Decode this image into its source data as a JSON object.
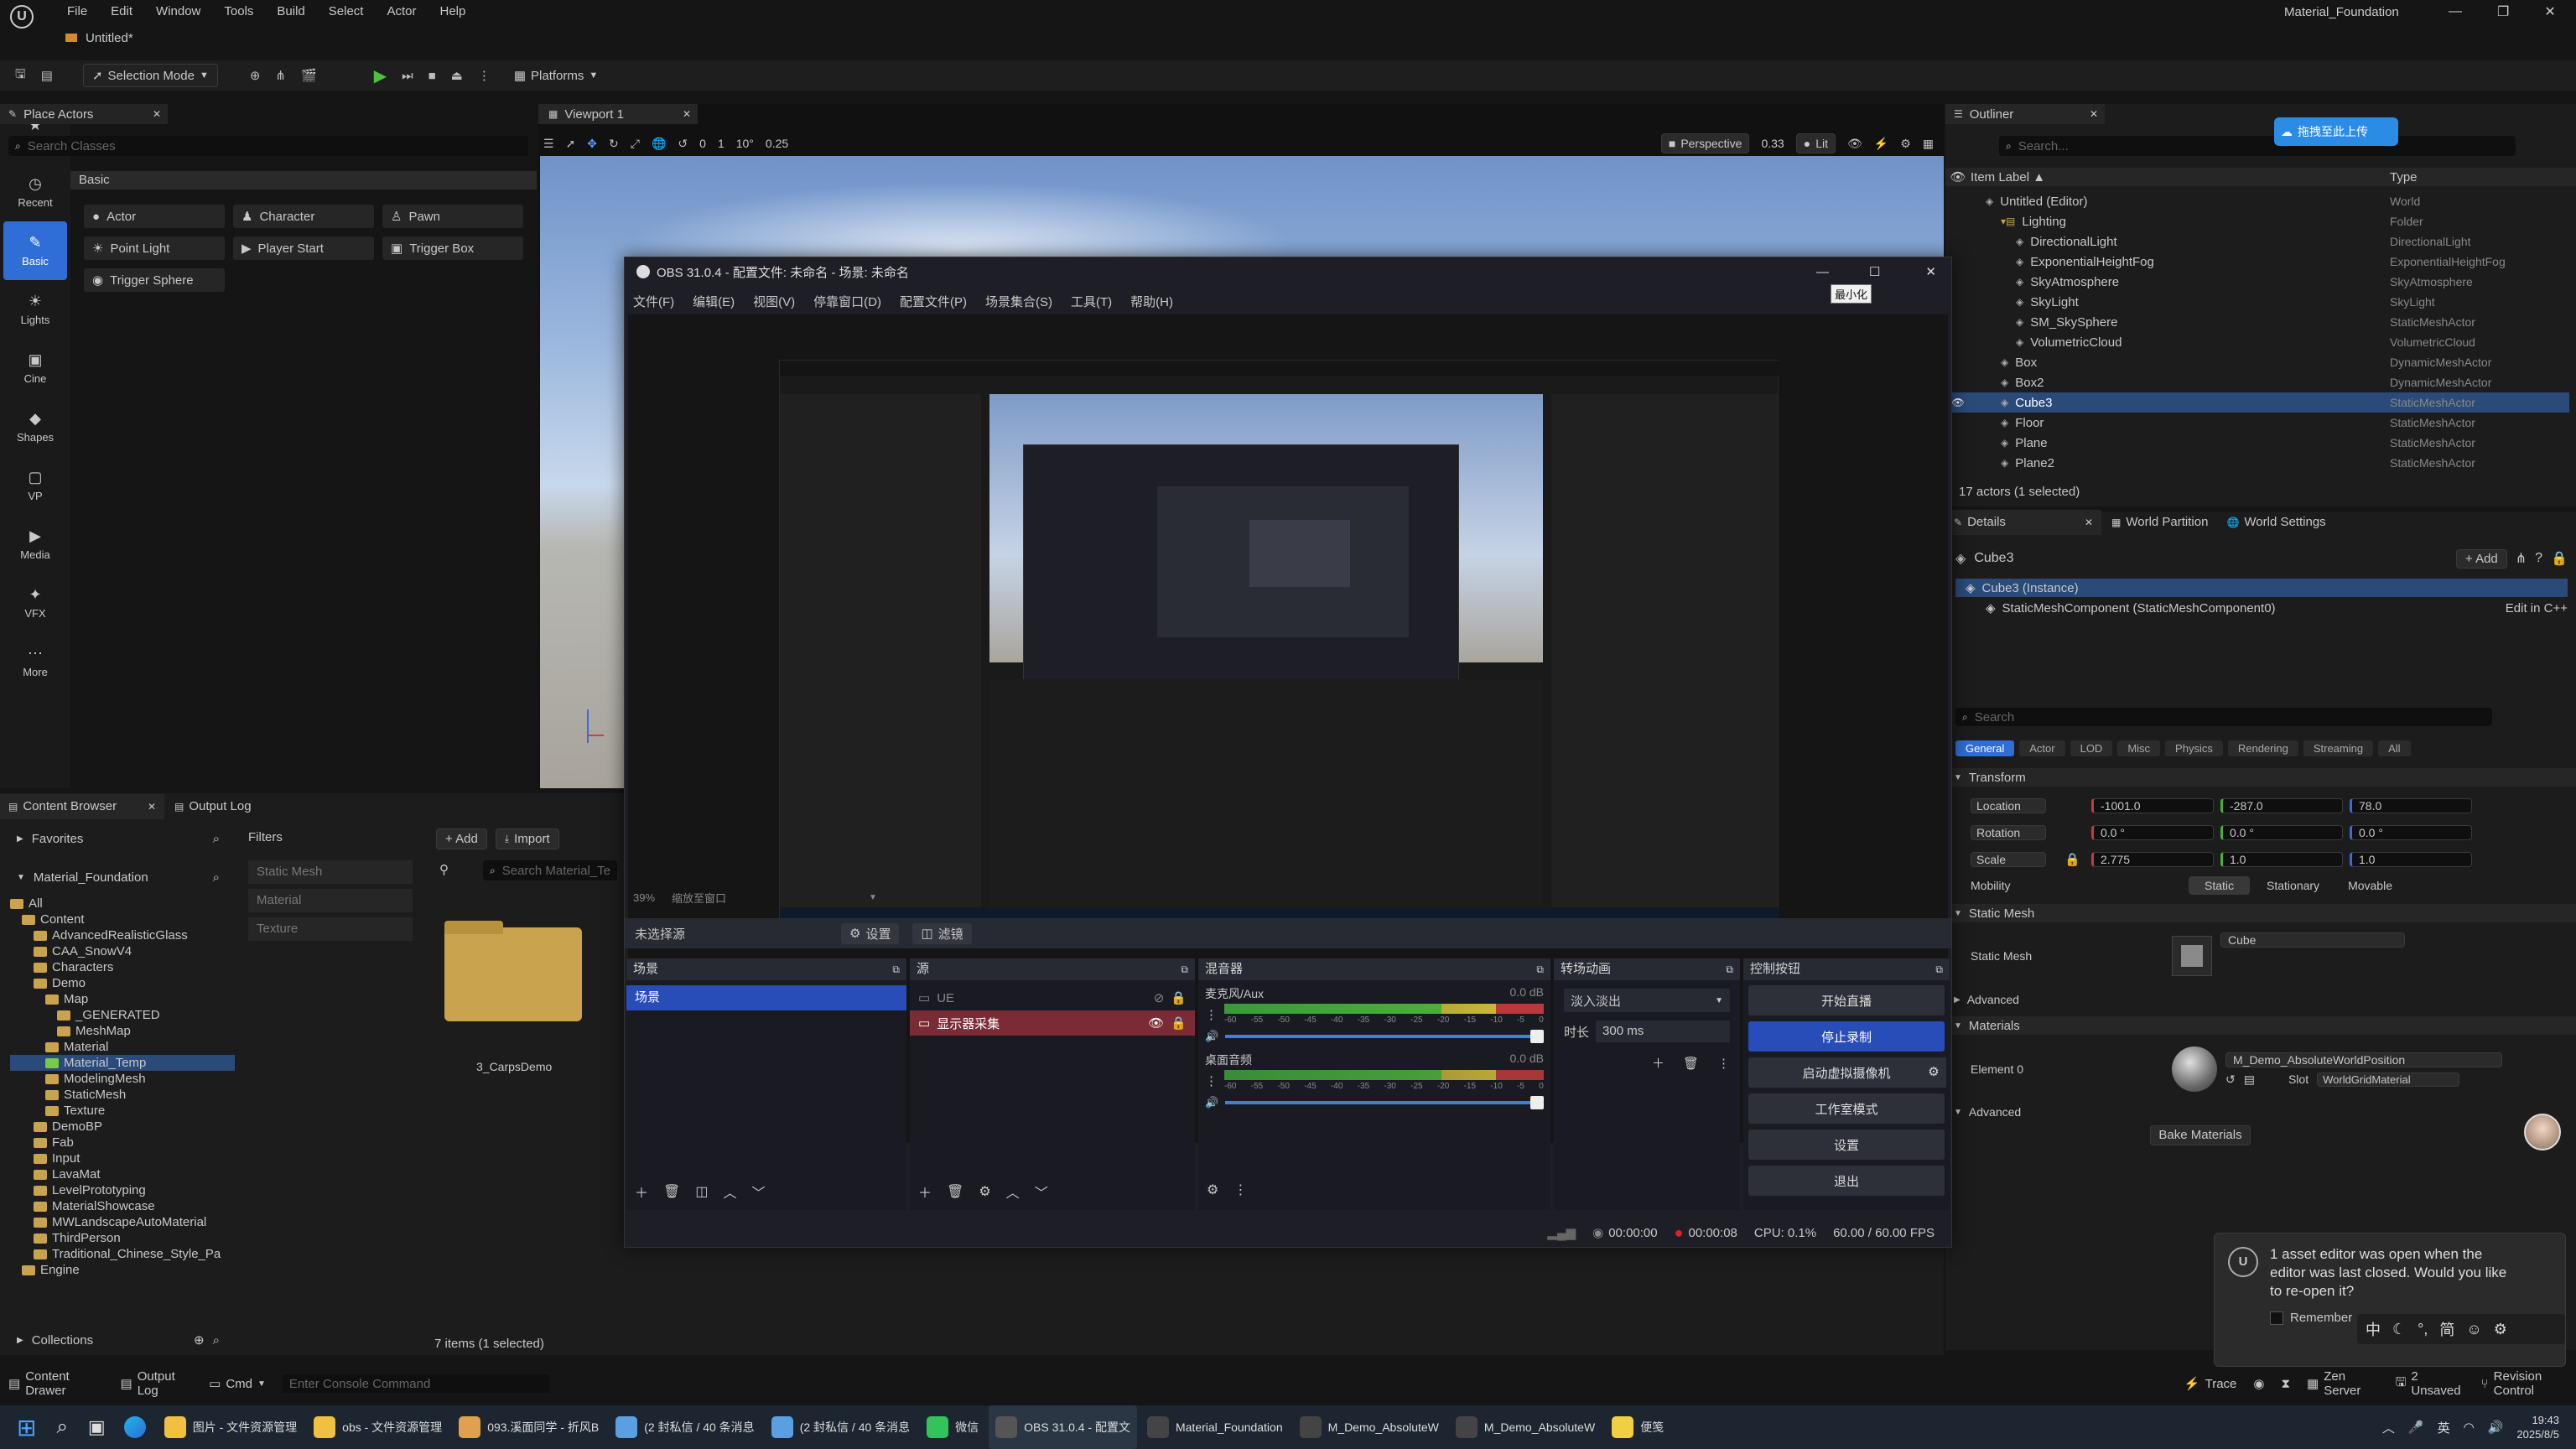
{
  "app": {
    "title": "Material_Foundation",
    "tab": "Untitled*"
  },
  "menu": [
    "File",
    "Edit",
    "Window",
    "Tools",
    "Build",
    "Select",
    "Actor",
    "Help"
  ],
  "toolbar": {
    "selection_mode": "Selection Mode",
    "platforms": "Platforms"
  },
  "place_actors": {
    "tab": "Place Actors",
    "search_placeholder": "Search Classes",
    "section": "Basic",
    "items": [
      "Actor",
      "Character",
      "Pawn",
      "Point Light",
      "Player Start",
      "Trigger Box",
      "Trigger Sphere"
    ],
    "side": [
      "Favorites",
      "Recent",
      "Basic",
      "Lights",
      "Cine",
      "Shapes",
      "VP",
      "Media",
      "VFX",
      "More"
    ]
  },
  "viewport": {
    "tab": "Viewport 1",
    "perspective": "Perspective",
    "fov": "0.33",
    "lit": "Lit",
    "snap_move": "10",
    "snap_rot": "10°",
    "snap_scale": "0.25",
    "grid": "0",
    "cam": "1"
  },
  "outliner": {
    "tab": "Outliner",
    "search_placeholder": "Search...",
    "upload_btn": "拖拽至此上传",
    "col_label": "Item Label ▲",
    "col_type": "Type",
    "rows": [
      {
        "label": "Untitled (Editor)",
        "type": "World",
        "indent": 1
      },
      {
        "label": "Lighting",
        "type": "Folder",
        "indent": 2
      },
      {
        "label": "DirectionalLight",
        "type": "DirectionalLight",
        "indent": 3
      },
      {
        "label": "ExponentialHeightFog",
        "type": "ExponentialHeightFog",
        "indent": 3
      },
      {
        "label": "SkyAtmosphere",
        "type": "SkyAtmosphere",
        "indent": 3
      },
      {
        "label": "SkyLight",
        "type": "SkyLight",
        "indent": 3
      },
      {
        "label": "SM_SkySphere",
        "type": "StaticMeshActor",
        "indent": 3
      },
      {
        "label": "VolumetricCloud",
        "type": "VolumetricCloud",
        "indent": 3
      },
      {
        "label": "Box",
        "type": "DynamicMeshActor",
        "indent": 2
      },
      {
        "label": "Box2",
        "type": "DynamicMeshActor",
        "indent": 2
      },
      {
        "label": "Cube3",
        "type": "StaticMeshActor",
        "indent": 2,
        "selected": true
      },
      {
        "label": "Floor",
        "type": "StaticMeshActor",
        "indent": 2
      },
      {
        "label": "Plane",
        "type": "StaticMeshActor",
        "indent": 2
      },
      {
        "label": "Plane2",
        "type": "StaticMeshActor",
        "indent": 2
      }
    ],
    "status": "17 actors (1 selected)"
  },
  "details": {
    "tab": "Details",
    "tab2": "World Partition",
    "tab3": "World Settings",
    "object": "Cube3",
    "add": "+ Add",
    "instance": "Cube3 (Instance)",
    "component": "StaticMeshComponent (StaticMeshComponent0)",
    "edit_cpp": "Edit in C++",
    "search_placeholder": "Search",
    "filters": [
      "General",
      "Actor",
      "LOD",
      "Misc",
      "Physics",
      "Rendering",
      "Streaming",
      "All"
    ],
    "transform": "Transform",
    "location": {
      "label": "Location",
      "x": "-1001.0",
      "y": "-287.0",
      "z": "78.0"
    },
    "rotation": {
      "label": "Rotation",
      "x": "0.0 °",
      "y": "0.0 °",
      "z": "0.0 °"
    },
    "scale": {
      "label": "Scale",
      "x": "2.775",
      "y": "1.0",
      "z": "1.0"
    },
    "mobility": {
      "label": "Mobility",
      "opts": [
        "Static",
        "Stationary",
        "Movable"
      ]
    },
    "static_mesh_section": "Static Mesh",
    "static_mesh_label": "Static Mesh",
    "static_mesh_value": "Cube",
    "advanced": "Advanced",
    "materials": "Materials",
    "element0": "Element 0",
    "material_value": "M_Demo_AbsoluteWorldPosition",
    "slot_label": "Slot",
    "slot_value": "WorldGridMaterial",
    "bake": "Bake Materials"
  },
  "content_browser": {
    "tab": "Content Browser",
    "tab2": "Output Log",
    "favorites": "Favorites",
    "project": "Material_Foundation",
    "add": "+ Add",
    "import": "Import",
    "search_placeholder": "Search Material_Te",
    "filters_title": "Filters",
    "filters": [
      "Static Mesh",
      "Material",
      "Texture"
    ],
    "tree": [
      {
        "label": "All",
        "d": 0
      },
      {
        "label": "Content",
        "d": 1
      },
      {
        "label": "AdvancedRealisticGlass",
        "d": 2
      },
      {
        "label": "CAA_SnowV4",
        "d": 2
      },
      {
        "label": "Characters",
        "d": 2
      },
      {
        "label": "Demo",
        "d": 2
      },
      {
        "label": "Map",
        "d": 3
      },
      {
        "label": "_GENERATED",
        "d": 4
      },
      {
        "label": "MeshMap",
        "d": 4
      },
      {
        "label": "Material",
        "d": 3
      },
      {
        "label": "Material_Temp",
        "d": 3,
        "selected": true
      },
      {
        "label": "ModelingMesh",
        "d": 3
      },
      {
        "label": "StaticMesh",
        "d": 3
      },
      {
        "label": "Texture",
        "d": 3
      },
      {
        "label": "DemoBP",
        "d": 2
      },
      {
        "label": "Fab",
        "d": 2
      },
      {
        "label": "Input",
        "d": 2
      },
      {
        "label": "LavaMat",
        "d": 2
      },
      {
        "label": "LevelPrototyping",
        "d": 2
      },
      {
        "label": "MaterialShowcase",
        "d": 2
      },
      {
        "label": "MWLandscapeAutoMaterial",
        "d": 2
      },
      {
        "label": "ThirdPerson",
        "d": 2
      },
      {
        "label": "Traditional_Chinese_Style_Pa",
        "d": 2
      },
      {
        "label": "Engine",
        "d": 1
      }
    ],
    "asset_name": "3_CarpsDemo",
    "collections": "Collections",
    "items_status": "7 items (1 selected)"
  },
  "bottom_bar": {
    "drawer": "Content Drawer",
    "output": "Output Log",
    "cmd": "Cmd",
    "console_placeholder": "Enter Console Command",
    "trace": "Trace",
    "zen": "Zen Server",
    "unsaved": "2 Unsaved",
    "revision": "Revision Control"
  },
  "toast": {
    "message": "1 asset editor was open when the editor was last closed. Would you like to re-open it?",
    "remember": "Remember"
  },
  "obs": {
    "title": "OBS 31.0.4 - 配置文件: 未命名 - 场景: 未命名",
    "menu": [
      "文件(F)",
      "编辑(E)",
      "视图(V)",
      "停靠窗口(D)",
      "配置文件(P)",
      "场景集合(S)",
      "工具(T)",
      "帮助(H)"
    ],
    "tooltip": "最小化",
    "zoom": "39%",
    "preview_label": "缩放至窗口",
    "no_source": "未选择源",
    "settings_btn": "设置",
    "filters_btn": "滤镜",
    "scenes_title": "场景",
    "scene_item": "场景",
    "sources_title": "源",
    "sources": [
      "UE",
      "显示器采集"
    ],
    "mixer_title": "混音器",
    "mixer": [
      {
        "name": "麦克风/Aux",
        "db": "0.0 dB"
      },
      {
        "name": "桌面音频",
        "db": "0.0 dB"
      }
    ],
    "meter_ticks": [
      "-60",
      "-55",
      "-50",
      "-45",
      "-40",
      "-35",
      "-30",
      "-25",
      "-20",
      "-15",
      "-10",
      "-5",
      "0"
    ],
    "transitions_title": "转场动画",
    "transition": "淡入淡出",
    "duration_label": "时长",
    "duration": "300 ms",
    "controls_title": "控制按钮",
    "controls": [
      "开始直播",
      "停止录制",
      "启动虚拟摄像机",
      "工作室模式",
      "设置",
      "退出"
    ],
    "status": {
      "stream_time": "00:00:00",
      "rec_time": "00:00:08",
      "cpu": "CPU: 0.1%",
      "fps": "60.00 / 60.00 FPS"
    }
  },
  "taskbar": {
    "items": [
      "图片 - 文件资源管理",
      "obs - 文件资源管理",
      "093.溪面同学 - 折风B",
      "(2 封私信 / 40 条消息",
      "(2 封私信 / 40 条消息",
      "微信",
      "OBS 31.0.4 - 配置文",
      "Material_Foundation",
      "M_Demo_AbsoluteW",
      "M_Demo_AbsoluteW",
      "便笺"
    ],
    "time": "19:43",
    "date": "2025/8/5",
    "ime": "英"
  },
  "colors": {
    "accent": "#2e6ed6",
    "obs_blue": "#284cb8",
    "record_red": "#c4302b",
    "folder": "#c9a34e"
  }
}
